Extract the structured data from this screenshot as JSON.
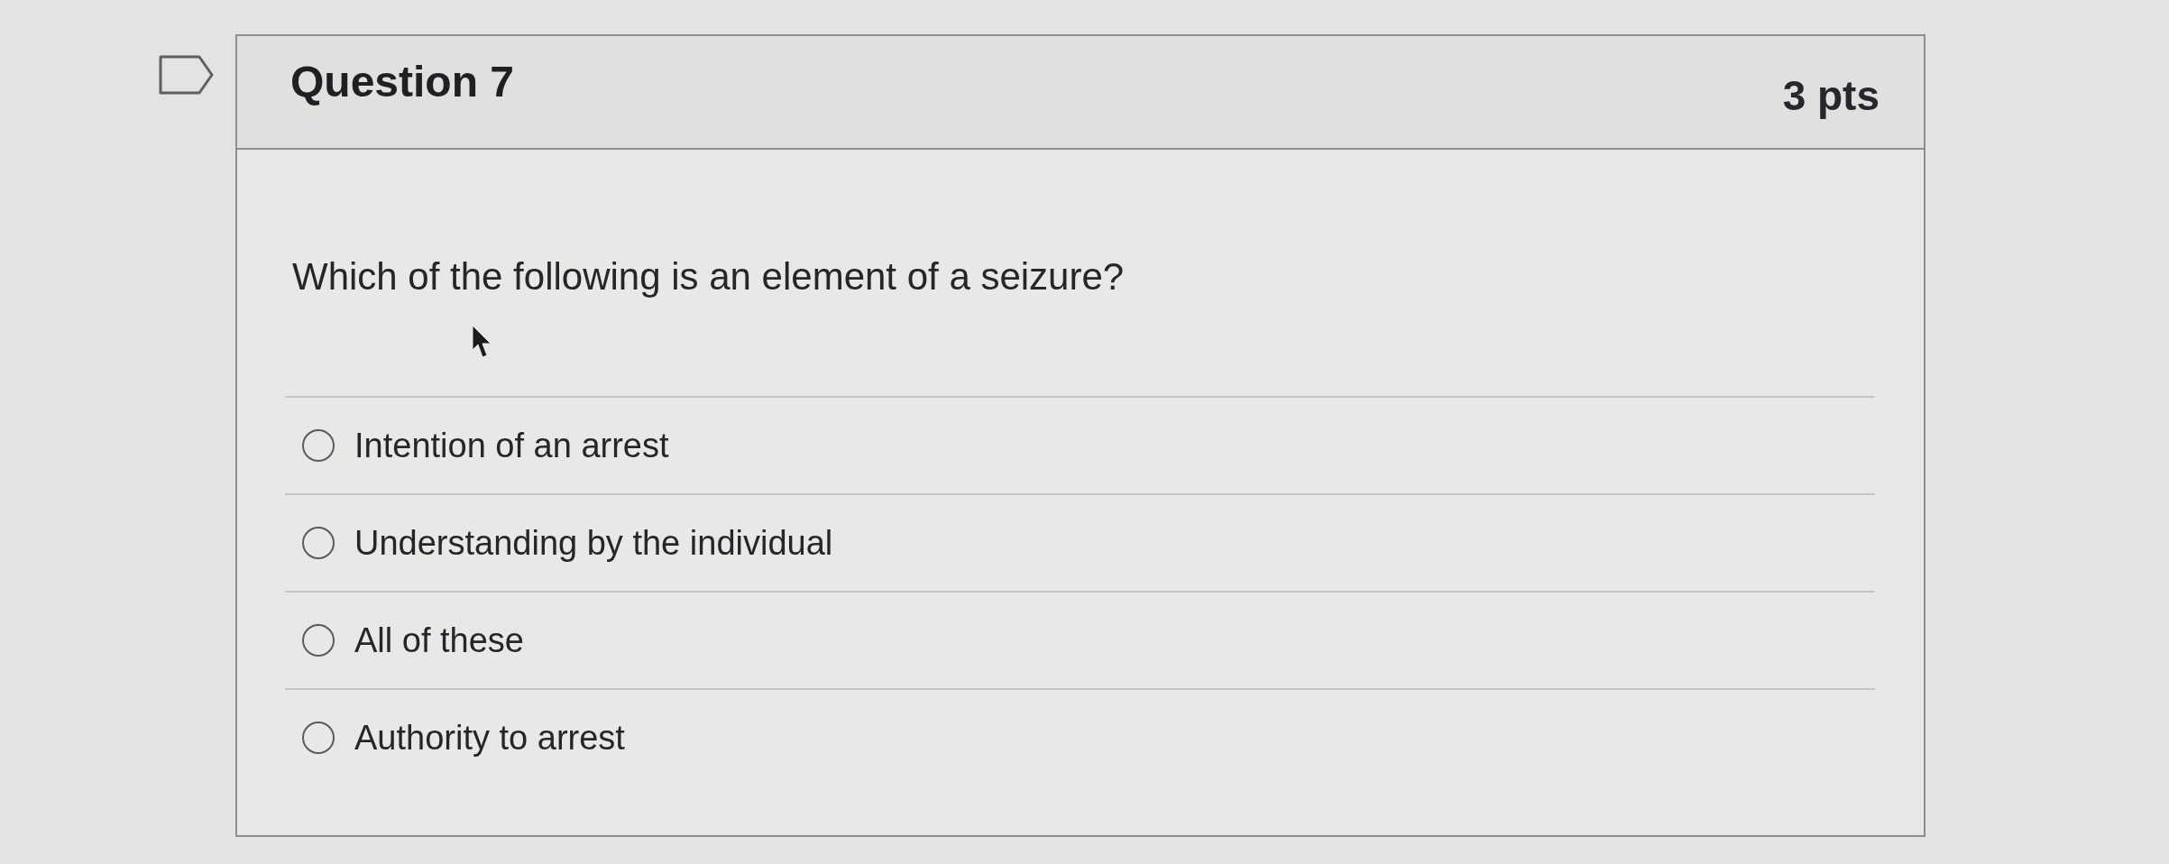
{
  "question": {
    "title": "Question 7",
    "points": "3 pts",
    "flagged": false,
    "text": "Which of the following is an element of a seizure?"
  },
  "answers": [
    {
      "label": "Intention of an arrest",
      "selected": false
    },
    {
      "label": "Understanding by the individual",
      "selected": false
    },
    {
      "label": "All of these",
      "selected": false
    },
    {
      "label": "Authority to arrest",
      "selected": false
    }
  ]
}
